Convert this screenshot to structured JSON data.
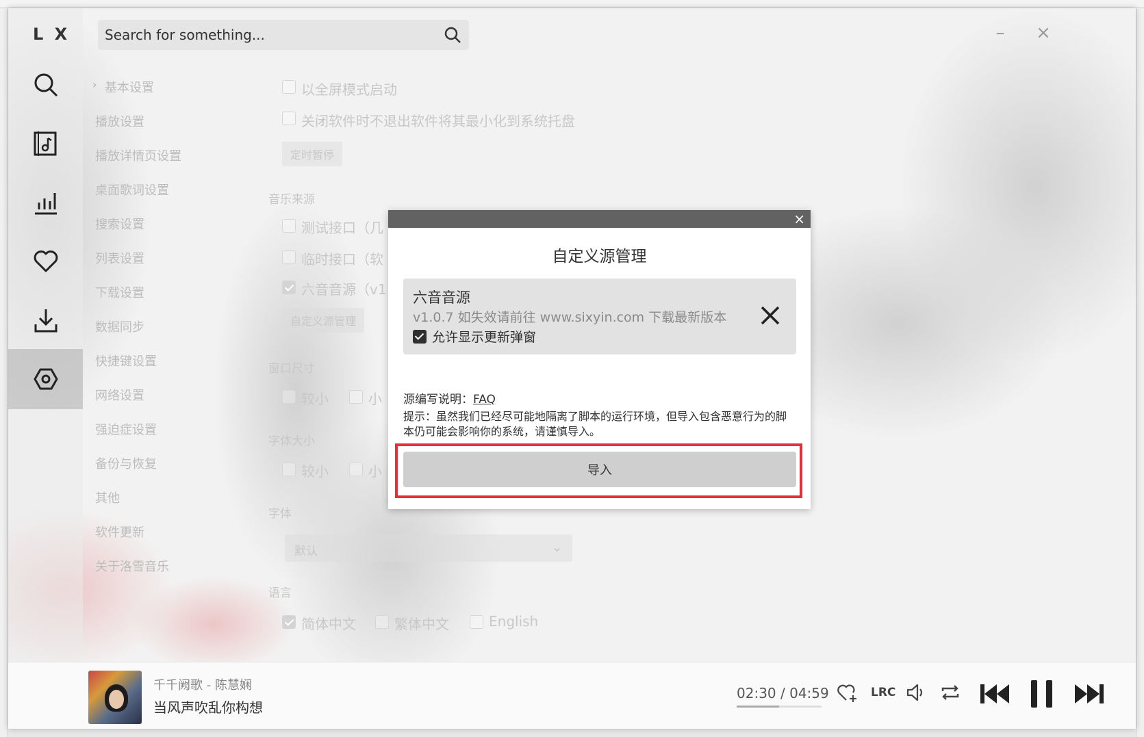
{
  "app": {
    "logo": "L X",
    "search_placeholder": "Search for something..."
  },
  "sidebar": {
    "items": [
      {
        "name": "search",
        "icon": "search-icon"
      },
      {
        "name": "songlist",
        "icon": "music-list-icon"
      },
      {
        "name": "leaderboard",
        "icon": "chart-icon"
      },
      {
        "name": "favorites",
        "icon": "heart-icon"
      },
      {
        "name": "downloads",
        "icon": "download-icon"
      },
      {
        "name": "settings",
        "icon": "settings-icon",
        "active": true
      }
    ]
  },
  "settings_nav": {
    "items": [
      "基本设置",
      "播放设置",
      "播放详情页设置",
      "桌面歌词设置",
      "搜索设置",
      "列表设置",
      "下载设置",
      "数据同步",
      "快捷键设置",
      "网络设置",
      "强迫症设置",
      "备份与恢复",
      "其他",
      "软件更新",
      "关于洛雪音乐"
    ]
  },
  "settings_panel": {
    "fullscreen": "以全屏模式启动",
    "tray": "关闭软件时不退出软件将其最小化到系统托盘",
    "timer_button": "定时暂停",
    "music_source_heading": "音乐来源",
    "source_test": "测试接口（几",
    "source_temp": "临时接口（软",
    "source_six": "六音音源（v1",
    "custom_source_button": "自定义源管理",
    "window_size_heading": "窗口尺寸",
    "window_smaller": "较小",
    "window_small": "小",
    "font_size_heading": "字体大小",
    "font_smaller": "较小",
    "font_small": "小",
    "font_heading": "字体",
    "font_select": "默认",
    "language_heading": "语言",
    "lang_zh_cn": "简体中文",
    "lang_zh_tw": "繁体中文",
    "lang_en": "English"
  },
  "modal": {
    "close": "×",
    "title": "自定义源管理",
    "source": {
      "name": "六音音源",
      "description": "v1.0.7 如失效请前往 www.sixyin.com 下载最新版本",
      "allow_update_popup": "允许显示更新弹窗"
    },
    "faq_prefix": "源编写说明：",
    "faq_link": "FAQ",
    "tip": "提示：虽然我们已经尽可能地隔离了脚本的运行环境，但导入包含恶意行为的脚本仍可能会影响你的系统，请谨慎导入。",
    "import_button": "导入"
  },
  "player": {
    "song": "千千阙歌 - 陈慧娴",
    "lyric": "当风声吹乱你构想",
    "current_time": "02:30",
    "separator": "/",
    "duration": "04:59",
    "progress": 0.5,
    "lrc": "LRC"
  },
  "colors": {
    "highlight_border": "#e5303a",
    "modal_header": "#626262"
  }
}
